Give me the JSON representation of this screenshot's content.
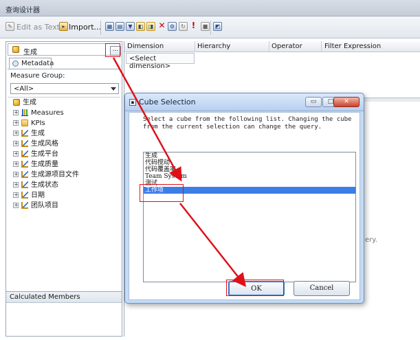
{
  "window": {
    "title": "查询设计器"
  },
  "toolbar": {
    "edit_as_text": "Edit as Text",
    "import": "Import..."
  },
  "left_pane": {
    "cube_name": "生成",
    "browse_label": "...",
    "tab_metadata": "Metadata",
    "measure_group_label": "Measure Group:",
    "measure_group_value": "<All>",
    "tree": [
      {
        "label": "生成",
        "icon": "cube-icon"
      },
      {
        "label": "Measures",
        "icon": "measures-icon"
      },
      {
        "label": "KPIs",
        "icon": "kpi-icon"
      },
      {
        "label": "生成",
        "icon": "dimension-icon"
      },
      {
        "label": "生成风格",
        "icon": "dimension-icon"
      },
      {
        "label": "生成平台",
        "icon": "dimension-icon"
      },
      {
        "label": "生成质量",
        "icon": "dimension-icon"
      },
      {
        "label": "生成源项目文件",
        "icon": "dimension-icon"
      },
      {
        "label": "生成状态",
        "icon": "dimension-icon"
      },
      {
        "label": "日期",
        "icon": "dimension-icon"
      },
      {
        "label": "团队项目",
        "icon": "dimension-icon"
      }
    ],
    "calculated_members": "Calculated Members"
  },
  "grid": {
    "col_dimension": "Dimension",
    "col_hierarchy": "Hierarchy",
    "col_operator": "Operator",
    "col_filter": "Filter Expression",
    "select_dimension": "<Select dimension>",
    "note_fragment": "ery."
  },
  "dialog": {
    "title": "Cube Selection",
    "message": "Select a cube from the following list. Changing the cube from the current selection can change the query.",
    "cubes": [
      "生成",
      "代码搅动",
      "代码覆盖率",
      "Team System",
      "测试",
      "工作项"
    ],
    "selected_index": 5,
    "ok": "OK",
    "cancel": "Cancel",
    "minimize": "▭",
    "maximize": "□",
    "close": "✕"
  },
  "annotation": {
    "color": "#e0101a"
  }
}
